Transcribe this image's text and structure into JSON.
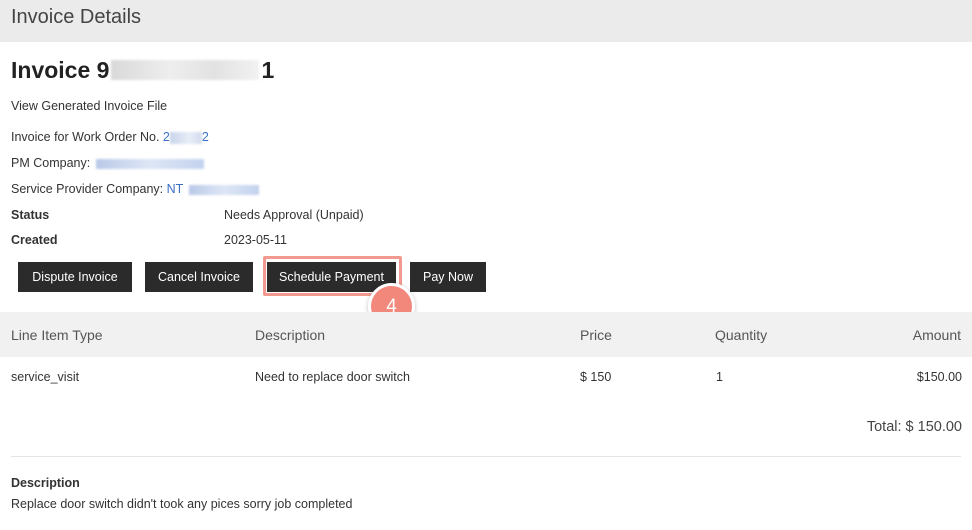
{
  "header": {
    "title": "Invoice Details"
  },
  "invoice": {
    "title_prefix": "Invoice 9",
    "title_suffix": "1",
    "view_file_link": "View Generated Invoice File",
    "work_order_label": "Invoice for Work Order No.",
    "work_order_prefix": "2",
    "work_order_suffix": "2",
    "pm_company_label": "PM Company:",
    "service_provider_label": "Service Provider Company:",
    "service_provider_prefix": "NT",
    "status_label": "Status",
    "status_value": "Needs Approval (Unpaid)",
    "created_label": "Created",
    "created_value": "2023-05-11"
  },
  "actions": {
    "dispute": "Dispute Invoice",
    "cancel": "Cancel Invoice",
    "schedule": "Schedule Payment",
    "pay_now": "Pay Now",
    "step_number": "4"
  },
  "table": {
    "headers": [
      "Line Item Type",
      "Description",
      "Price",
      "Quantity",
      "Amount"
    ],
    "rows": [
      {
        "type": "service_visit",
        "description": "Need to replace door switch",
        "price": "$ 150",
        "quantity": "1",
        "amount": "$150.00"
      }
    ]
  },
  "total": "Total: $ 150.00",
  "description": {
    "label": "Description",
    "text": "Replace door switch didn't took any pices sorry job completed"
  },
  "colors": {
    "button_bg": "#2b2b2b",
    "highlight": "#f29a8f",
    "step_badge": "#f2887c",
    "link": "#3a6fc4"
  }
}
